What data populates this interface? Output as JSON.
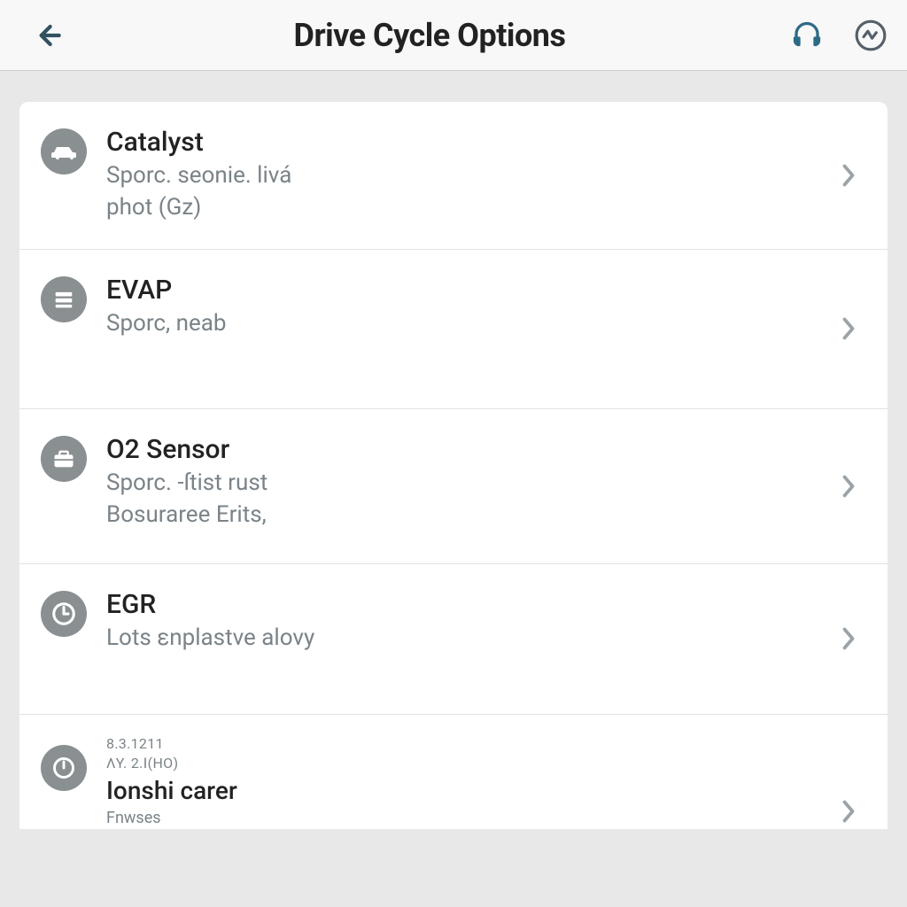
{
  "header": {
    "title": "Drive Cycle Options"
  },
  "items": [
    {
      "icon": "car-icon",
      "title": "Catalyst",
      "sub": "Sporc. seonie. livá",
      "sub2": "phot (Gz)"
    },
    {
      "icon": "stack-icon",
      "title": "EVAP",
      "sub": "Sporc, neab",
      "sub2": ""
    },
    {
      "icon": "case-icon",
      "title": "O2 Sensor",
      "sub": "Sporc. -ſtist rust",
      "sub2": "Bosuraree Erits,"
    },
    {
      "icon": "gauge-icon",
      "title": "EGR",
      "sub": "Lots εnplastve alovy",
      "sub2": ""
    },
    {
      "icon": "power-icon",
      "meta": "8.3.1211",
      "meta2": "ΛY. 2.Ⅰ(HO)",
      "title": "Ionshi carer",
      "sub": "Fnwses",
      "sub2": ""
    }
  ]
}
